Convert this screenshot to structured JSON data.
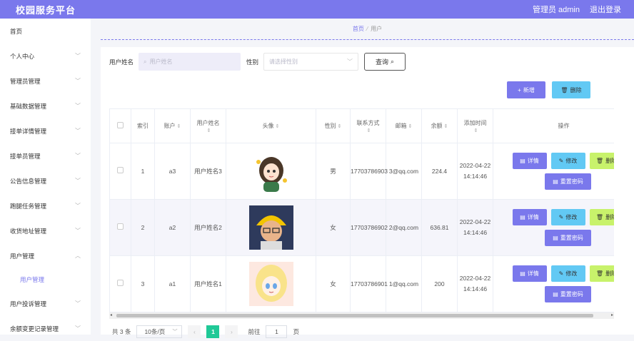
{
  "header": {
    "title": "校园服务平台",
    "admin_label": "管理员 admin",
    "logout_label": "退出登录"
  },
  "sidebar": {
    "items": [
      {
        "label": "首页",
        "chev": ""
      },
      {
        "label": "个人中心",
        "chev": "﹀"
      },
      {
        "label": "管理员管理",
        "chev": "﹀"
      },
      {
        "label": "基础数据管理",
        "chev": "﹀"
      },
      {
        "label": "接单详情管理",
        "chev": "﹀"
      },
      {
        "label": "接单员管理",
        "chev": "﹀"
      },
      {
        "label": "公告信息管理",
        "chev": "﹀"
      },
      {
        "label": "跑腿任务管理",
        "chev": "﹀"
      },
      {
        "label": "收货地址管理",
        "chev": "﹀"
      },
      {
        "label": "用户管理",
        "chev": "︿"
      }
    ],
    "sub_item": "用户管理",
    "items_after": [
      {
        "label": "用户投诉管理",
        "chev": "﹀"
      },
      {
        "label": "余额变更记录管理",
        "chev": "﹀"
      }
    ]
  },
  "breadcrumb": {
    "home": "首页",
    "sep": "⁄",
    "current": "用户"
  },
  "search": {
    "name_label": "用户姓名",
    "name_placeholder": "用户姓名",
    "gender_label": "性别",
    "gender_placeholder": "请选择性别",
    "query_label": "查询"
  },
  "toolbar": {
    "add_label": "新增",
    "delete_label": "删除"
  },
  "table": {
    "headers": {
      "index": "索引",
      "account": "账户",
      "name": "用户姓名",
      "avatar": "头像",
      "gender": "性别",
      "phone": "联系方式",
      "email": "邮箱",
      "balance": "余额",
      "created": "添加时间",
      "ops": "操作"
    },
    "sort_icon": "⇕",
    "rows": [
      {
        "index": "1",
        "account": "a3",
        "name": "用户姓名3",
        "gender": "男",
        "phone": "17703786903",
        "email": "3@qq.com",
        "balance": "224.4",
        "created": "2022-04-22 14:14:46"
      },
      {
        "index": "2",
        "account": "a2",
        "name": "用户姓名2",
        "gender": "女",
        "phone": "17703786902",
        "email": "2@qq.com",
        "balance": "636.81",
        "created": "2022-04-22 14:14:46"
      },
      {
        "index": "3",
        "account": "a1",
        "name": "用户姓名1",
        "gender": "女",
        "phone": "17703786901",
        "email": "1@qq.com",
        "balance": "200",
        "created": "2022-04-22 14:14:46"
      }
    ],
    "op_labels": {
      "detail": "详情",
      "edit": "修改",
      "delete": "删除",
      "reset": "重置密码"
    }
  },
  "pager": {
    "total": "共 3 条",
    "page_size": "10条/页",
    "current": "1",
    "goto_label": "前往",
    "goto_value": "1",
    "page_unit": "页"
  },
  "colors": {
    "primary": "#7a78ec",
    "info": "#62c9f4",
    "lime": "#c8f26b",
    "pager_active": "#20c997"
  }
}
